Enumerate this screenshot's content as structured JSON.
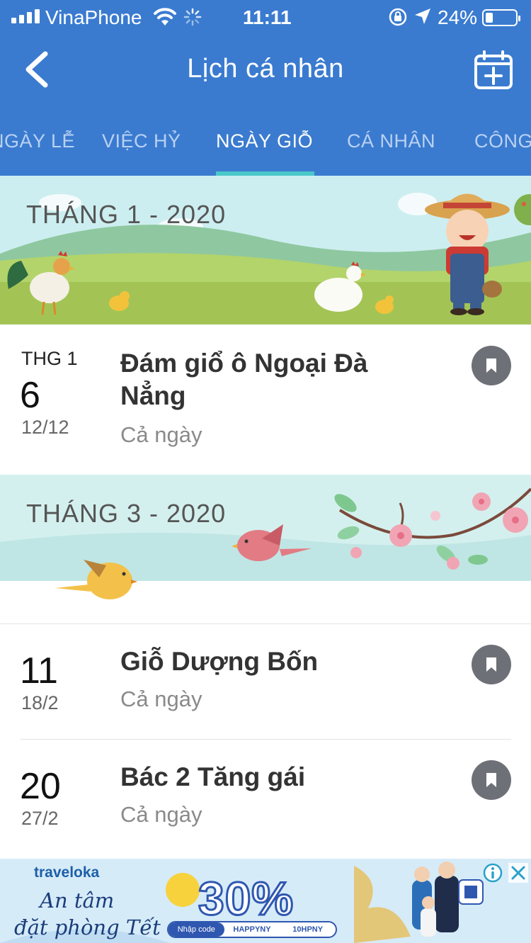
{
  "status_bar": {
    "carrier": "VinaPhone",
    "time": "11:11",
    "battery": "24%",
    "battery_level": 0.24,
    "icons": [
      "signal-icon",
      "wifi-icon",
      "loading-icon",
      "rotation-lock-icon",
      "location-arrow-icon",
      "battery-icon"
    ]
  },
  "header": {
    "title": "Lịch cá nhân",
    "back_icon": "chevron-left-icon",
    "add_icon": "calendar-add-icon"
  },
  "tabs": [
    {
      "label": "NGÀY LỄ",
      "active": false
    },
    {
      "label": "VIỆC HỶ",
      "active": false
    },
    {
      "label": "NGÀY GIỖ",
      "active": true
    },
    {
      "label": "CÁ NHÂN",
      "active": false
    },
    {
      "label": "CÔNG",
      "active": false
    }
  ],
  "sections": [
    {
      "month_label": "THÁNG 1 - 2020",
      "events": [
        {
          "month_abbr": "THG 1",
          "day": "6",
          "lunar": "12/12",
          "title": "Đám giổ ô Ngoại Đà Nẳng",
          "time": "Cả ngày"
        }
      ]
    },
    {
      "month_label": "THÁNG 3 - 2020",
      "events": [
        {
          "month_abbr": "",
          "day": "11",
          "lunar": "18/2",
          "title": "Giỗ Dượng Bốn",
          "time": "Cả ngày"
        },
        {
          "month_abbr": "",
          "day": "20",
          "lunar": "27/2",
          "title": "Bác 2 Tăng gái",
          "time": "Cả ngày"
        }
      ]
    }
  ],
  "ad": {
    "brand": "traveloka",
    "slogan_line1": "An tâm",
    "slogan_line2": "đặt phòng Tết",
    "discount": "30%",
    "code_label": "Nhập code",
    "codes": [
      "HAPPYNY",
      "10HPNY"
    ],
    "info_icon": "info-icon",
    "close_icon": "close-icon"
  },
  "colors": {
    "header_bg": "#3a7bd0",
    "tab_indicator": "#49c7c9",
    "bookmark_bg": "#6e7077",
    "ad_accent": "#2f57b0"
  }
}
